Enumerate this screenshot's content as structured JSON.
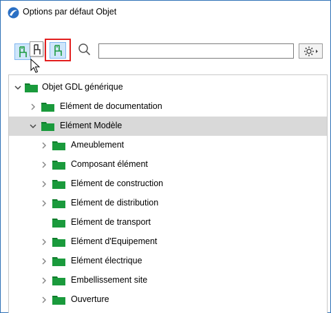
{
  "window": {
    "title": "Options par défaut Objet"
  },
  "toolbar": {
    "search": {
      "value": "",
      "placeholder": ""
    },
    "icons": [
      "app-logo-icon",
      "object-library-icon",
      "object-tooltip-icon",
      "object-highlighted-icon",
      "search-icon",
      "settings-gear-icon"
    ]
  },
  "tree": {
    "items": [
      {
        "label": "Objet GDL générique",
        "level": 0,
        "expanded": true,
        "has_children": true,
        "selected": false
      },
      {
        "label": "Elément de documentation",
        "level": 1,
        "expanded": false,
        "has_children": true,
        "selected": false
      },
      {
        "label": "Elément Modèle",
        "level": 1,
        "expanded": true,
        "has_children": true,
        "selected": true
      },
      {
        "label": "Ameublement",
        "level": 2,
        "expanded": false,
        "has_children": true,
        "selected": false
      },
      {
        "label": "Composant élément",
        "level": 2,
        "expanded": false,
        "has_children": true,
        "selected": false
      },
      {
        "label": "Elément de construction",
        "level": 2,
        "expanded": false,
        "has_children": true,
        "selected": false
      },
      {
        "label": "Elément de distribution",
        "level": 2,
        "expanded": false,
        "has_children": true,
        "selected": false
      },
      {
        "label": "Elément de transport",
        "level": 2,
        "expanded": false,
        "has_children": false,
        "selected": false
      },
      {
        "label": "Elément d'Equipement",
        "level": 2,
        "expanded": false,
        "has_children": true,
        "selected": false
      },
      {
        "label": "Elément électrique",
        "level": 2,
        "expanded": false,
        "has_children": true,
        "selected": false
      },
      {
        "label": "Embellissement site",
        "level": 2,
        "expanded": false,
        "has_children": true,
        "selected": false
      },
      {
        "label": "Ouverture",
        "level": 2,
        "expanded": false,
        "has_children": true,
        "selected": false
      }
    ]
  },
  "colors": {
    "folder": "#1a9a3c",
    "folder_dark": "#0d7a2a",
    "selection": "#d9d9d9",
    "highlight_box": "#e21d1d",
    "button_active": "#cfe6fb",
    "app_logo": "#2a6fc4"
  }
}
